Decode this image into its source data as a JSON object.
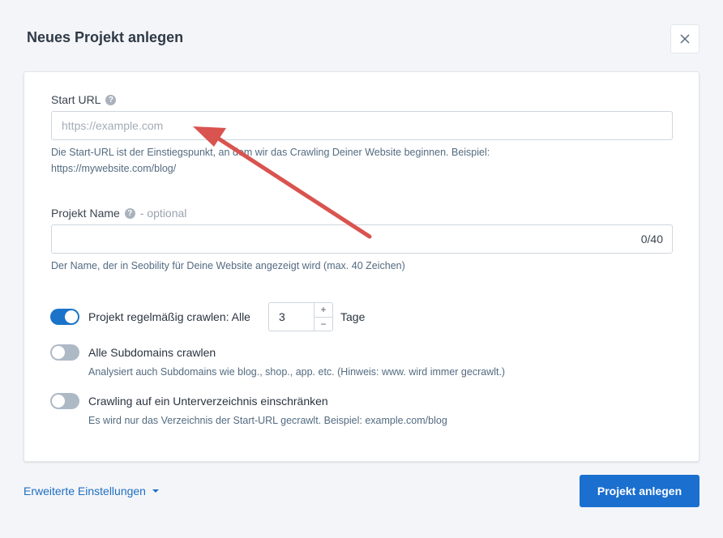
{
  "dialog": {
    "title": "Neues Projekt anlegen",
    "close_icon": "close-icon"
  },
  "start_url": {
    "label": "Start URL",
    "help_icon": "question-circle-icon",
    "placeholder": "https://example.com",
    "value": "",
    "hint": "Die Start-URL ist der Einstiegspunkt, an dem wir das Crawling Deiner Website beginnen. Beispiel: https://mywebsite.com/blog/"
  },
  "project_name": {
    "label": "Projekt Name",
    "help_icon": "question-circle-icon",
    "optional": "- optional",
    "value": "",
    "counter": "0/40",
    "hint": "Der Name, der in Seobility für Deine Website angezeigt wird (max. 40 Zeichen)"
  },
  "options": {
    "recrawl": {
      "enabled": true,
      "label": "Projekt regelmäßig crawlen: Alle",
      "interval": "3",
      "unit": "Tage",
      "plus": "+",
      "minus": "−"
    },
    "subdomains": {
      "enabled": false,
      "label": "Alle Subdomains crawlen",
      "hint": "Analysiert auch Subdomains wie blog., shop., app. etc. (Hinweis: www. wird immer gecrawlt.)"
    },
    "subdirectory": {
      "enabled": false,
      "label": "Crawling auf ein Unterverzeichnis einschränken",
      "hint": "Es wird nur das Verzeichnis der Start-URL gecrawlt. Beispiel: example.com/blog"
    }
  },
  "footer": {
    "advanced_label": "Erweiterte Einstellungen",
    "submit_label": "Projekt anlegen"
  },
  "colors": {
    "primary": "#1a6fcf",
    "toggle_on": "#1a73c9",
    "toggle_off": "#aeb9c6",
    "annotation_arrow": "#d9534f"
  }
}
